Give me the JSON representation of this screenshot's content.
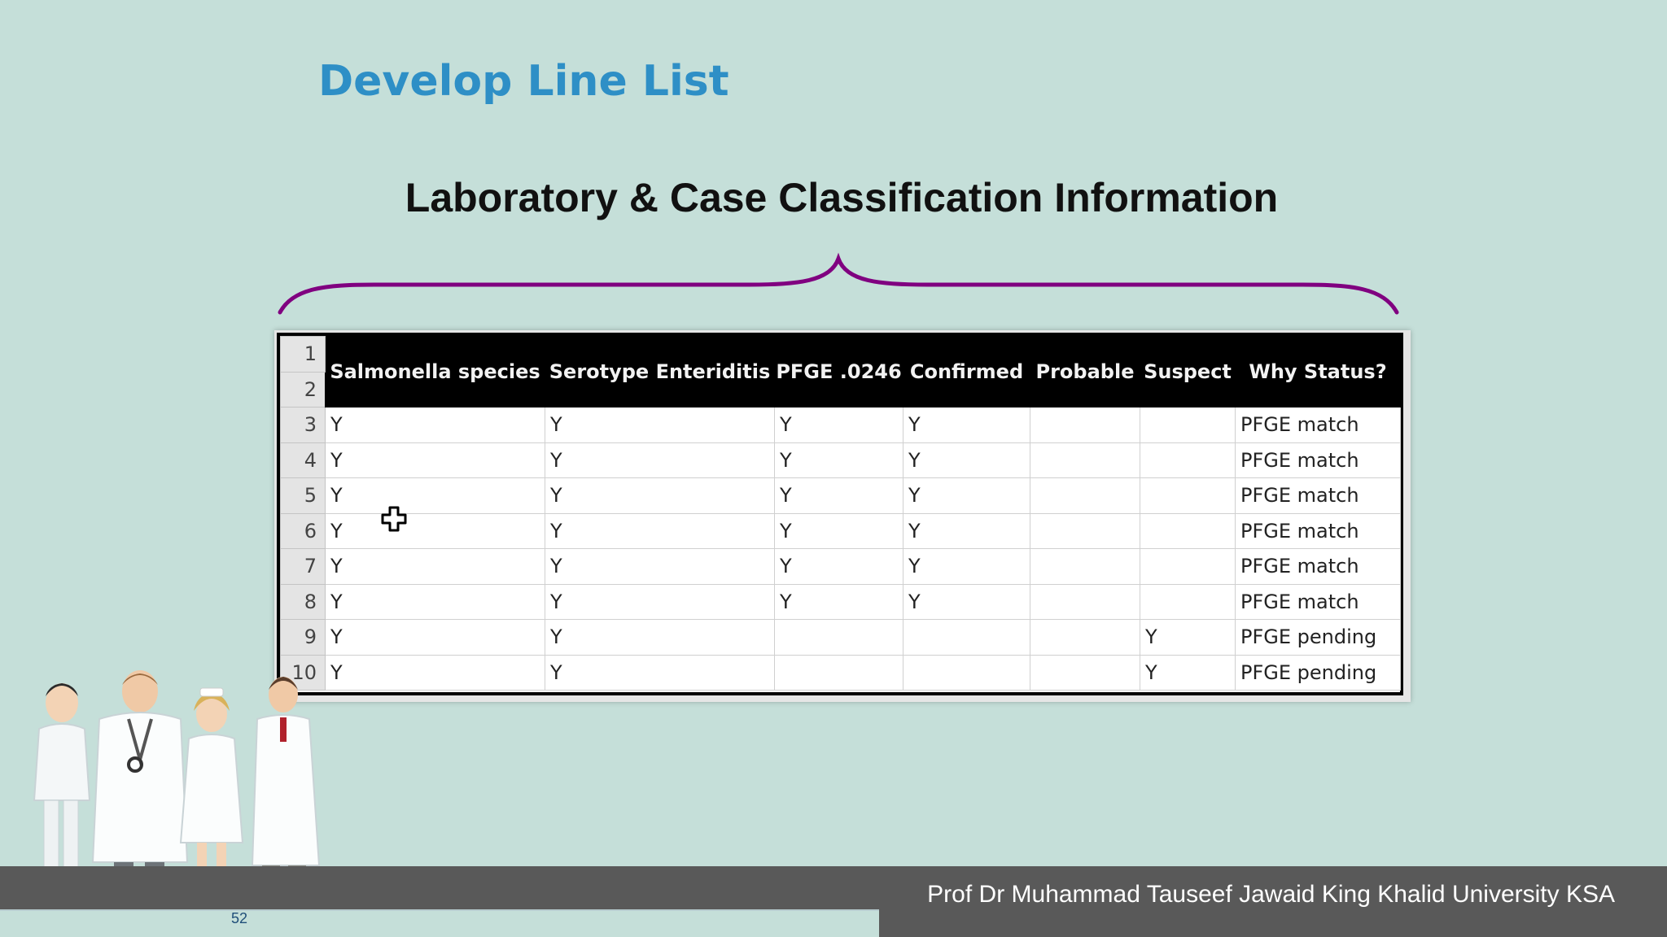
{
  "slide": {
    "title": "Develop Line List",
    "subtitle": "Laboratory & Case Classification Information",
    "page_number": "52",
    "footer_text": "Prof Dr Muhammad Tauseef Jawaid King Khalid University KSA",
    "colors": {
      "background": "#c5dfd9",
      "title": "#2e8fc6",
      "brace": "#800080",
      "footer": "#595959"
    }
  },
  "table": {
    "headers": [
      "Salmonella species",
      "Serotype Enteriditis",
      "PFGE .0246",
      "Confirmed",
      "Probable",
      "Suspect",
      "Why Status?"
    ],
    "header_row_numbers": [
      "1",
      "2"
    ],
    "rows": [
      {
        "num": "3",
        "cells": [
          "Y",
          "Y",
          "Y",
          "Y",
          "",
          "",
          "PFGE match"
        ]
      },
      {
        "num": "4",
        "cells": [
          "Y",
          "Y",
          "Y",
          "Y",
          "",
          "",
          "PFGE match"
        ]
      },
      {
        "num": "5",
        "cells": [
          "Y",
          "Y",
          "Y",
          "Y",
          "",
          "",
          "PFGE match"
        ]
      },
      {
        "num": "6",
        "cells": [
          "Y",
          "Y",
          "Y",
          "Y",
          "",
          "",
          "PFGE match"
        ]
      },
      {
        "num": "7",
        "cells": [
          "Y",
          "Y",
          "Y",
          "Y",
          "",
          "",
          "PFGE match"
        ]
      },
      {
        "num": "8",
        "cells": [
          "Y",
          "Y",
          "Y",
          "Y",
          "",
          "",
          "PFGE match"
        ]
      },
      {
        "num": "9",
        "cells": [
          "Y",
          "Y",
          "",
          "",
          "",
          "Y",
          "PFGE pending"
        ]
      },
      {
        "num": "10",
        "cells": [
          "Y",
          "Y",
          "",
          "",
          "",
          "Y",
          "PFGE pending"
        ]
      }
    ]
  },
  "icons": {
    "cursor": "move-cursor-icon",
    "people": "medical-staff-illustration"
  }
}
